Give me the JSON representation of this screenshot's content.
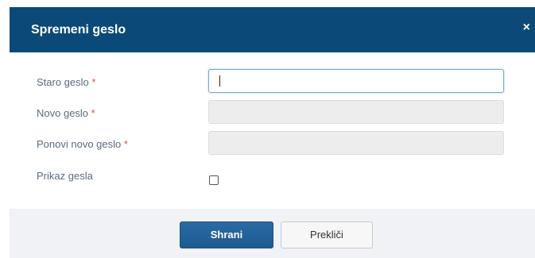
{
  "dialog": {
    "title": "Spremeni geslo",
    "close_symbol": "×",
    "colors": {
      "header_bg": "#0b4a78",
      "primary_button": "#1c5a92",
      "required_marker": "#d9534f"
    }
  },
  "form": {
    "required_marker": "*",
    "old_password": {
      "label": "Staro geslo",
      "value": ""
    },
    "new_password": {
      "label": "Novo geslo",
      "value": ""
    },
    "repeat_new_password": {
      "label": "Ponovi novo geslo",
      "value": ""
    },
    "show_password": {
      "label": "Prikaz gesla",
      "checked": false
    }
  },
  "footer": {
    "save_label": "Shrani",
    "cancel_label": "Prekliči"
  }
}
